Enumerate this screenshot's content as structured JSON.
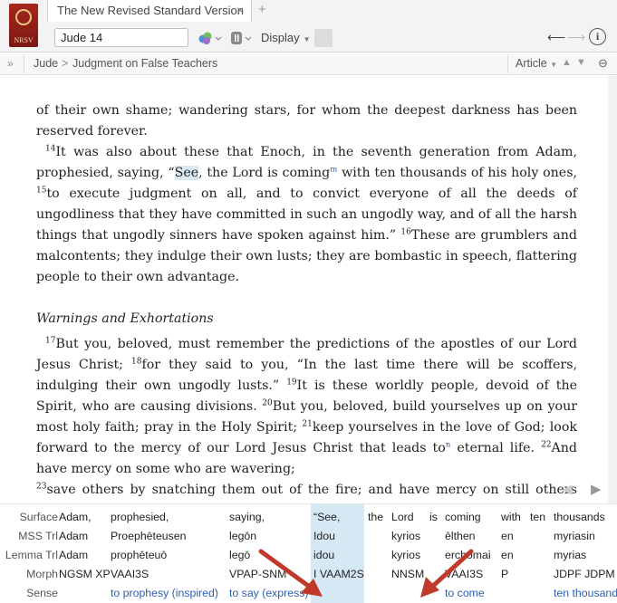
{
  "app": {
    "logo_text": "NRSV",
    "tab_title": "The New Revised Standard Version",
    "reference_value": "Jude 14",
    "display_label": "Display",
    "icons": {
      "tab_close": "close-icon",
      "tab_add": "plus-icon",
      "parallel": "parallel-resources-icon",
      "panel": "panel-menu-icon",
      "back": "back-arrow-icon",
      "forward": "forward-arrow-icon",
      "info": "info-icon"
    }
  },
  "breadcrumb": {
    "expand": "»",
    "book": "Jude",
    "separator": ">",
    "section": "Judgment on False Teachers",
    "article_label": "Article"
  },
  "text": {
    "p1": "of their own shame; wandering stars, for whom the deepest darkness has been reserved forever.",
    "v14_num": "14",
    "v14_a": "It was also about these that Enoch, in the seventh generation from Adam, prophesied, saying, “",
    "v14_see": "See",
    "v14_b": ", the Lord is coming",
    "v14_fn": "m",
    "v14_c": " with ten thousands of his holy ones, ",
    "v15_num": "15",
    "v15": "to execute judgment on all, and to convict everyone of all the deeds of ungodliness that they have committed in such an ungodly way, and of all the harsh things that ungodly sinners have spoken against him.” ",
    "v16_num": "16",
    "v16": "These are grumblers and malcontents; they indulge their own lusts; they are bombastic in speech, flattering people to their own advantage.",
    "heading": "Warnings and Exhortations",
    "v17_num": "17",
    "v17": "But you, beloved, must remember the predictions of the apostles of our Lord Jesus Christ; ",
    "v18_num": "18",
    "v18": "for they said to you, “In the last time there will be scoffers, indulging their own ungodly lusts.” ",
    "v19_num": "19",
    "v19": "It is these worldly people, devoid of the Spirit, who are causing divisions. ",
    "v20_num": "20",
    "v20": "But you, beloved, build yourselves up on your most holy faith; pray in the Holy Spirit; ",
    "v21_num": "21",
    "v21_a": "keep yourselves in the love of God; look forward to the mercy of our Lord Jesus Christ that leads to",
    "v21_fn": "n",
    "v21_b": " eternal life. ",
    "v22_num": "22",
    "v22": "And have mercy on some who are wavering; ",
    "v23_num": "23",
    "v23": "save others by snatching them out of the fire; and have mercy on still others with"
  },
  "interlinear": {
    "row_labels": [
      "Surface",
      "MSS Trl",
      "Lemma Trl",
      "Morph",
      "Sense"
    ],
    "columns": [
      {
        "surface": "Adam,",
        "mss": "Adam",
        "lemma": "Adam",
        "morph": "NGSM XP",
        "sense": ""
      },
      {
        "surface": "prophesied,",
        "mss": "Proephēteusen",
        "lemma": "prophēteuō",
        "morph": "VAAI3S",
        "sense": "to prophesy (inspired)"
      },
      {
        "surface": "saying,",
        "mss": "legōn",
        "lemma": "legō",
        "morph": "VPAP-SNM",
        "sense": "to say (express)"
      },
      {
        "surface": "“See,",
        "mss": "Idou",
        "lemma": "idou",
        "morph": "I VAAM2S",
        "sense": ""
      },
      {
        "surface": "the",
        "mss": "",
        "lemma": "",
        "morph": "",
        "sense": ""
      },
      {
        "surface": "Lord",
        "mss": "kyrios",
        "lemma": "kyrios",
        "morph": "NNSM",
        "sense": ""
      },
      {
        "surface": "is",
        "mss": "",
        "lemma": "",
        "morph": "",
        "sense": ""
      },
      {
        "surface": "coming",
        "mss": "ēlthen",
        "lemma": "erchomai",
        "morph": "VAAI3S",
        "sense": "to come"
      },
      {
        "surface": "with",
        "mss": "en",
        "lemma": "en",
        "morph": "P",
        "sense": ""
      },
      {
        "surface": "ten",
        "mss": "",
        "lemma": "",
        "morph": "",
        "sense": ""
      },
      {
        "surface": "thousands",
        "mss": "myriasin",
        "lemma": "myrias",
        "morph": "JDPF JDPM",
        "sense": "ten thousand"
      }
    ]
  },
  "colors": {
    "highlight": "#d6e8f4",
    "sense_link": "#2d5fb3",
    "annotation_arrow": "#c0392b"
  }
}
